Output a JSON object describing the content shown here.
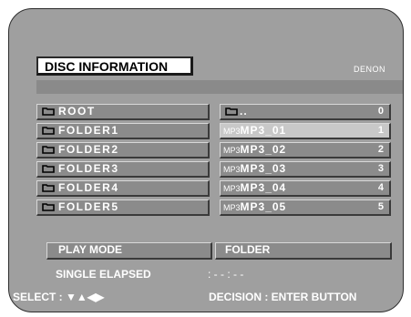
{
  "header": {
    "title": "DISC INFORMATION",
    "brand": "DENON"
  },
  "folders": [
    {
      "label": "ROOT"
    },
    {
      "label": "FOLDER1"
    },
    {
      "label": "FOLDER2"
    },
    {
      "label": "FOLDER3"
    },
    {
      "label": "FOLDER4"
    },
    {
      "label": "FOLDER5"
    }
  ],
  "files": [
    {
      "prefix": "",
      "label": "..",
      "num": "0",
      "icon": "folder-icon"
    },
    {
      "prefix": "MP3",
      "label": "MP3_01",
      "num": "1"
    },
    {
      "prefix": "MP3",
      "label": "MP3_02",
      "num": "2"
    },
    {
      "prefix": "MP3",
      "label": "MP3_03",
      "num": "3"
    },
    {
      "prefix": "MP3",
      "label": "MP3_04",
      "num": "4"
    },
    {
      "prefix": "MP3",
      "label": "MP3_05",
      "num": "5"
    }
  ],
  "play_mode": {
    "label": "PLAY MODE",
    "value": "FOLDER"
  },
  "elapsed": {
    "label": "SINGLE ELAPSED",
    "value": ": - - : - -"
  },
  "footer": {
    "select": "SELECT : ▼▲◀▶",
    "decision": "DECISION : ENTER BUTTON"
  },
  "colors": {
    "background": "#9f9f9f",
    "selected_row": "#c8c8c8",
    "text": "#ffffff"
  }
}
